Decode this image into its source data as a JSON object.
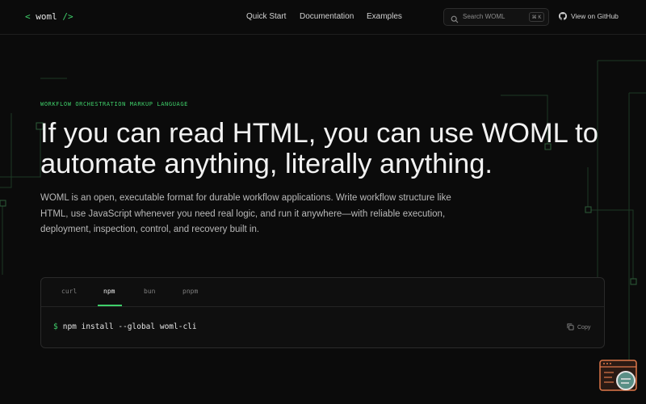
{
  "header": {
    "logo": {
      "open": "<",
      "name": "woml",
      "close": "/>"
    },
    "nav": [
      "Quick Start",
      "Documentation",
      "Examples"
    ],
    "search": {
      "placeholder": "Search WOML",
      "shortcut": "⌘ K"
    },
    "github_label": "View on GitHub"
  },
  "hero": {
    "eyebrow": "WORKFLOW ORCHESTRATION MARKUP LANGUAGE",
    "headline_line1": "If you can read HTML, you can use WOML to",
    "headline_line2": "automate anything, literally anything.",
    "description": "WOML is an open, executable format for durable workflow applications. Write workflow structure like HTML, use JavaScript whenever you need real logic, and run it anywhere—with reliable execution, deployment, inspection, control, and recovery built in."
  },
  "install": {
    "tabs": [
      "curl",
      "npm",
      "bun",
      "pnpm"
    ],
    "active_tab": "npm",
    "prompt": "$",
    "command": "npm install --global woml-cli",
    "copy_label": "Copy"
  },
  "colors": {
    "accent": "#3fcf6a",
    "background": "#0b0b0b",
    "widget": "#e0784a"
  },
  "icons": [
    "search-icon",
    "github-icon",
    "copy-icon",
    "help-widget-icon"
  ]
}
